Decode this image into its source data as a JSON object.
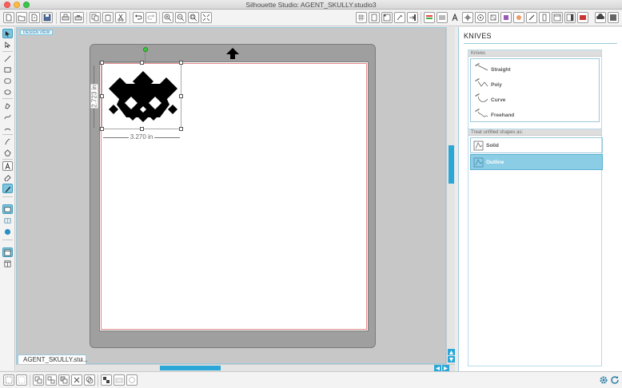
{
  "window": {
    "title": "Silhouette Studio: AGENT_SKULLY.studio3"
  },
  "colors": {
    "accent": "#2aa7d6",
    "selected_bg": "#8ccde6",
    "mat": "#9f9f9f",
    "cut_border": "#e38a8a"
  },
  "toolbar": {
    "icons": [
      "new-file-icon",
      "open-file-icon",
      "open-recent-icon",
      "save-icon",
      "print-icon",
      "print-cut-icon",
      "copy-icon",
      "paste-icon",
      "cut-icon",
      "undo-icon",
      "redo-icon",
      "pan-icon",
      "zoom-in-icon",
      "zoom-out-icon",
      "zoom-select-icon",
      "fit-to-page-icon",
      "grid-icon",
      "page-setup-icon",
      "registration-icon",
      "cut-settings-icon",
      "send-icon",
      "fill-icon",
      "line-icon",
      "text-icon",
      "transform-icon",
      "replicate-icon",
      "modify-icon",
      "offset-icon",
      "trace-icon",
      "knife-icon",
      "eraser-icon",
      "library-icon",
      "store-icon",
      "cloud-icon"
    ]
  },
  "canvas": {
    "view_tab": "DESIGN VIEW",
    "width_label": "3.270 in",
    "height_label": "2.723 in"
  },
  "doc_tab": {
    "name": "AGENT_SKULLY.stu...",
    "close": "x"
  },
  "panel": {
    "title": "KNIVES",
    "knives_header": "Knives",
    "knives": [
      "Straight",
      "Poly",
      "Curve",
      "Freehand"
    ],
    "treat_header": "Treat unfilled shapes as:",
    "treat_options": [
      "Solid",
      "Outline"
    ],
    "treat_selected": "Outline"
  }
}
